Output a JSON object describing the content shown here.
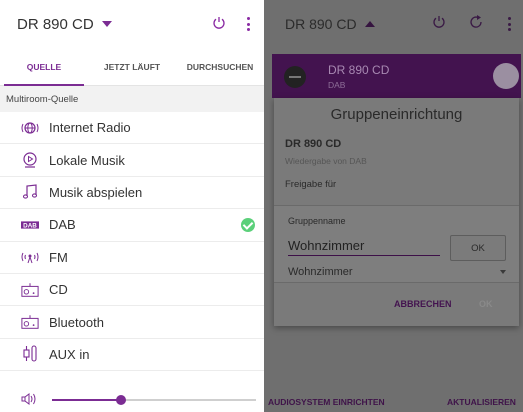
{
  "left": {
    "device_title": "DR 890 CD",
    "tabs": [
      {
        "label": "QUELLE"
      },
      {
        "label": "JETZT LÄUFT"
      },
      {
        "label": "DURCHSUCHEN"
      }
    ],
    "section_header": "Multiroom-Quelle",
    "sources": [
      {
        "label": "Internet Radio",
        "icon": "internet-radio-icon"
      },
      {
        "label": "Lokale Musik",
        "icon": "local-music-icon"
      },
      {
        "label": "Musik abspielen",
        "icon": "music-note-icon"
      },
      {
        "label": "DAB",
        "icon": "dab-icon",
        "selected": true
      },
      {
        "label": "FM",
        "icon": "fm-icon"
      },
      {
        "label": "CD",
        "icon": "cd-icon"
      },
      {
        "label": "Bluetooth",
        "icon": "bluetooth-icon"
      },
      {
        "label": "AUX in",
        "icon": "aux-in-icon"
      }
    ],
    "volume_fraction": 0.34,
    "accent_color": "#7b2c93",
    "check_color": "#5bd07a"
  },
  "right": {
    "device_title": "DR 890 CD",
    "device_bar": {
      "name": "DR 890 CD",
      "sub": "DAB"
    },
    "dialog": {
      "title": "Gruppeneinrichtung",
      "device_name": "DR 890 CD",
      "device_sub": "Wiedergabe von DAB",
      "share_label": "Freigabe für",
      "group_name_label": "Gruppenname",
      "group_name_value": "Wohnzimmer",
      "ok_label": "OK",
      "select_value": "Wohnzimmer",
      "cancel_label": "ABBRECHEN",
      "confirm_label": "OK"
    },
    "footer": {
      "left": "AUDIOSYSTEM EINRICHTEN",
      "right": "AKTUALISIEREN"
    }
  }
}
